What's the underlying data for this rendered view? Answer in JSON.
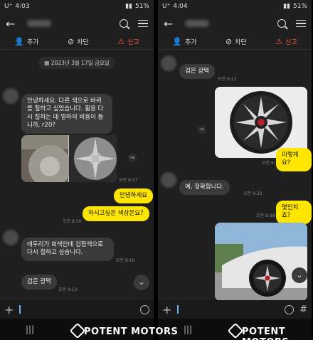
{
  "left": {
    "status": {
      "time": "4:03",
      "carrier": "U⁺",
      "battery": "51%"
    },
    "actions": {
      "add": "추가",
      "block": "차단",
      "report": "신고"
    },
    "date": "2023년 3월 17일 금요일",
    "messages": {
      "m1": "안녕하세요.  다른 색으로 바퀴를 칠하고 싶었습니다. 휠을 다시 칠하는 데 얼마의 비용이 듭니까, r20?",
      "t_img": "오전 8:27",
      "m2": "안녕하세요",
      "m3": "하시고싶은 색상은요?",
      "t3": "오전 8:30",
      "m4": "테두리가 회색인데 검정색으로 다시 칠하고 싶습니다.",
      "t4": "오전 9:10",
      "m5": "검은 광택",
      "t5": "오전 9:13"
    }
  },
  "right": {
    "status": {
      "time": "4:04",
      "carrier": "U⁺",
      "battery": "51%"
    },
    "actions": {
      "add": "추가",
      "block": "차단",
      "report": "신고"
    },
    "messages": {
      "m1": "검은 광택",
      "t1": "오전 9:13",
      "t_img": "오전 9:16",
      "m2": "이렇게요?",
      "m3": "예, 정확합니다.",
      "t3": "오전 9:33",
      "t4": "오전 9:38",
      "m4": "몇인치죠?"
    }
  },
  "watermark": "POTENT MOTORS",
  "colors": {
    "my_bubble": "#fee500",
    "their_bubble": "#3a3a3a",
    "report": "#ff5a3c",
    "background": "#1f1f1f"
  }
}
